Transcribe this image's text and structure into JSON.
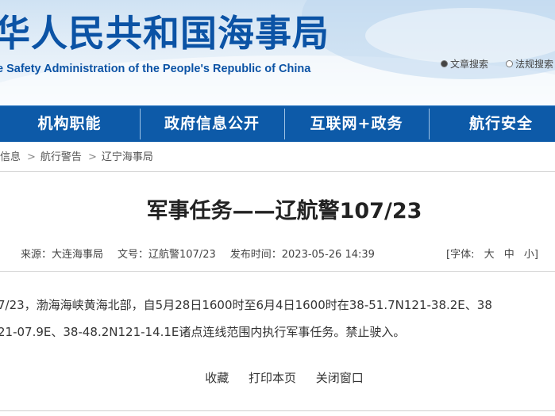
{
  "header": {
    "title": "华人民共和国海事局",
    "subtitle": "e Safety Administration of the People's Republic of China",
    "links": [
      {
        "label": "文章搜索"
      },
      {
        "label": "法规搜索"
      }
    ]
  },
  "nav": {
    "items": [
      {
        "label": "机构职能"
      },
      {
        "label": "政府信息公开"
      },
      {
        "label": "互联网+政务"
      },
      {
        "label": "航行安全"
      }
    ]
  },
  "breadcrumb": {
    "items": [
      "信息",
      "航行警告",
      "辽宁海事局"
    ],
    "separator": ">"
  },
  "article": {
    "title": "军事任务——辽航警107/23",
    "meta": {
      "source": "来源：大连海事局",
      "doc_no": "文号：辽航警107/23",
      "published": "发布时间：2023-05-26 14:39"
    },
    "font_size": {
      "open": "[字体:",
      "large": "大",
      "medium": "中",
      "small": "小",
      "close": "]"
    },
    "body_lines": [
      "7/23，渤海海峡黄海北部，自5月28日1600时至6月4日1600时在38-51.7N121-38.2E、38",
      "21-07.9E、38-48.2N121-14.1E诸点连线范围内执行军事任务。禁止驶入。"
    ]
  },
  "actions": {
    "favorite": "收藏",
    "print": "打印本页",
    "close": "关闭窗口"
  },
  "colors": {
    "title_blue": "#0b53a5",
    "nav_blue": "#0d5aa8"
  }
}
